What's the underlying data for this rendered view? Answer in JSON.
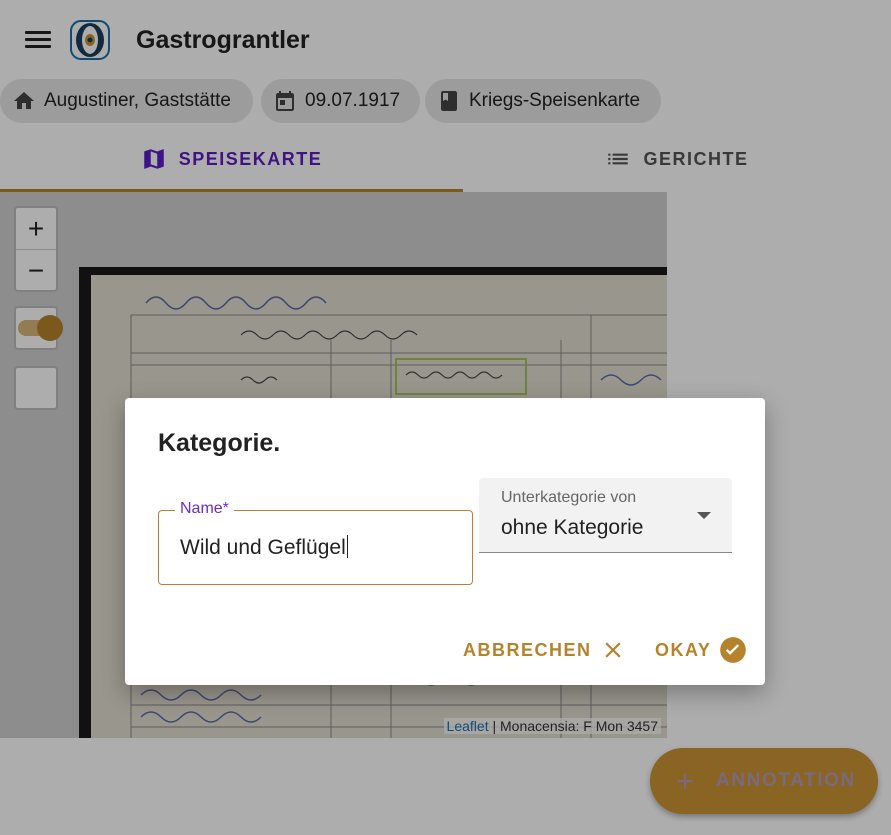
{
  "app": {
    "title": "Gastrograntler"
  },
  "chips": [
    {
      "label": "Augustiner, Gaststätte",
      "icon": "home-icon"
    },
    {
      "label": "09.07.1917",
      "icon": "calendar-icon"
    },
    {
      "label": "Kriegs-Speisenkarte",
      "icon": "book-icon"
    }
  ],
  "tabs": [
    {
      "label": "SPEISEKARTE",
      "icon": "map-icon",
      "active": true
    },
    {
      "label": "GERICHTE",
      "icon": "list-icon",
      "active": false
    }
  ],
  "map": {
    "zoom_in": "+",
    "zoom_out": "−",
    "attribution_link": "Leaflet",
    "attribution_text": " | Monacensia: F Mon 3457"
  },
  "dialog": {
    "title": "Kategorie.",
    "name_label": "Name*",
    "name_value": "Wild und Geflügel",
    "parent_label": "Unterkategorie von",
    "parent_value": "ohne Kategorie",
    "cancel_label": "ABBRECHEN",
    "ok_label": "OKAY"
  },
  "fab": {
    "label": "ANNOTATION"
  },
  "colors": {
    "accent": "#b5832c",
    "primary_tab": "#5a1cc6",
    "chip_bg": "#e6e6e6"
  }
}
